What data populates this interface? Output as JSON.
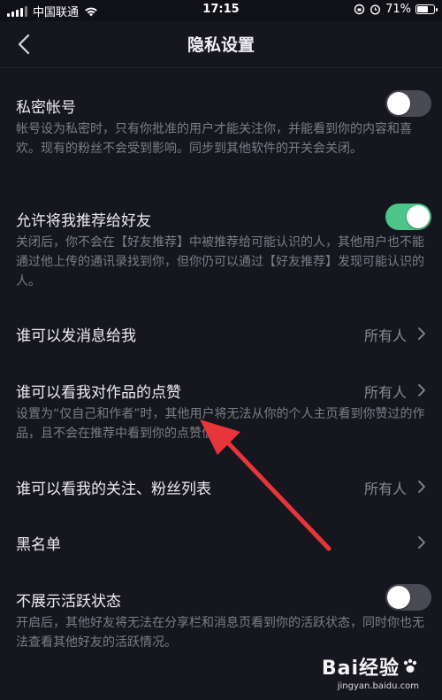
{
  "status_bar": {
    "carrier": "中国联通",
    "time": "17:15",
    "battery_text": "71%",
    "battery_level": 0.71
  },
  "header": {
    "title": "隐私设置"
  },
  "settings": {
    "private_account": {
      "label": "私密帐号",
      "desc": "帐号设为私密时，只有你批准的用户才能关注你，并能看到你的内容和喜欢。现有的粉丝不会受到影响。同步到其他软件的开关会关闭。",
      "enabled": false
    },
    "recommend_to_friends": {
      "label": "允许将我推荐给好友",
      "desc": "关闭后，你不会在【好友推荐】中被推荐给可能认识的人，其他用户也不能通过他上传的通讯录找到你，但你仍可以通过【好友推荐】发现可能认识的人。",
      "enabled": true
    },
    "who_can_message": {
      "label": "谁可以发消息给我",
      "value": "所有人"
    },
    "who_can_see_likes": {
      "label": "谁可以看我对作品的点赞",
      "value": "所有人",
      "desc": "设置为“仅自己和作者”时，其他用户将无法从你的个人主页看到你赞过的作品，且不会在推荐中看到你的点赞信息。"
    },
    "who_can_see_follow_list": {
      "label": "谁可以看我的关注、粉丝列表",
      "value": "所有人"
    },
    "blacklist": {
      "label": "黑名单"
    },
    "hide_active_status": {
      "label": "不展示活跃状态",
      "desc": "开启后，其他好友将无法在分享栏和消息页看到你的活跃状态，同时你也无法查看其他好友的活跃情况。",
      "enabled": false
    }
  },
  "colors": {
    "background": "#16161f",
    "toggle_on": "#4cc48a",
    "toggle_off": "#4a4a55",
    "annotation_arrow": "#e8353a"
  },
  "watermark": {
    "brand": "Bai经验",
    "url": "jingyan.baidu.com"
  }
}
